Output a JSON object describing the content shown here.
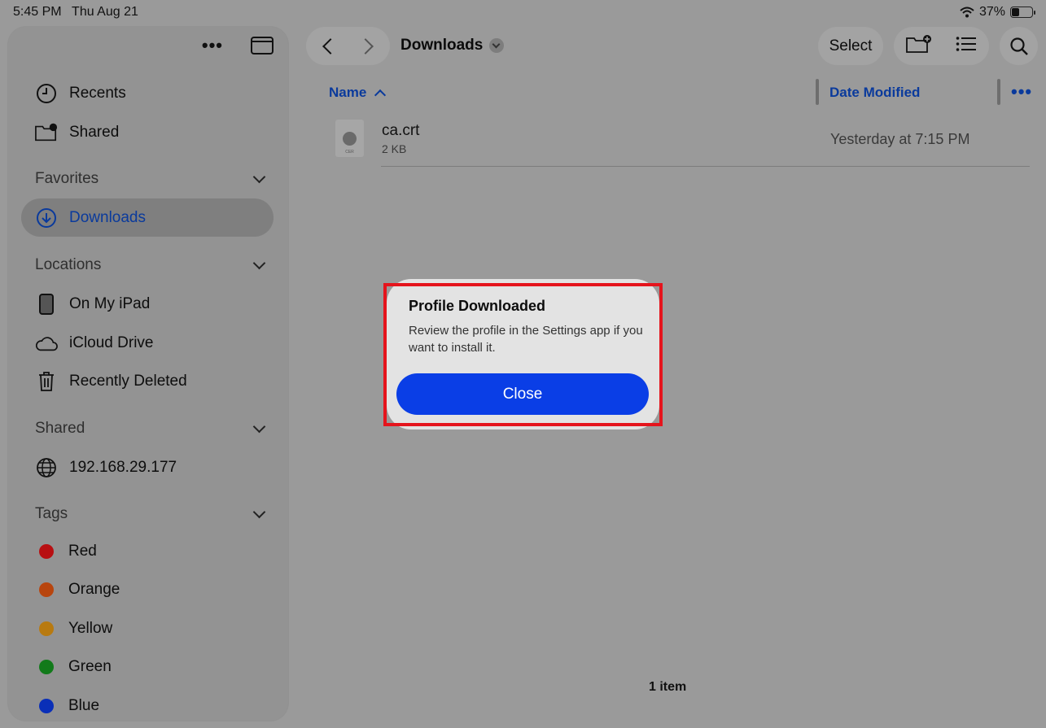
{
  "status_bar": {
    "time": "5:45 PM",
    "date": "Thu Aug 21",
    "battery": "37%",
    "battery_level": 0.37
  },
  "sidebar": {
    "top_items": [
      {
        "label": "Recents",
        "icon": "clock-icon"
      },
      {
        "label": "Shared",
        "icon": "shared-folder-icon"
      }
    ],
    "favorites": {
      "title": "Favorites",
      "items": [
        {
          "label": "Downloads",
          "icon": "download-icon",
          "selected": true
        }
      ]
    },
    "locations": {
      "title": "Locations",
      "items": [
        {
          "label": "On My iPad",
          "icon": "ipad-icon"
        },
        {
          "label": "iCloud Drive",
          "icon": "cloud-icon"
        },
        {
          "label": "Recently Deleted",
          "icon": "trash-icon"
        }
      ]
    },
    "shared": {
      "title": "Shared",
      "items": [
        {
          "label": "192.168.29.177",
          "icon": "globe-icon"
        }
      ]
    },
    "tags": {
      "title": "Tags",
      "items": [
        {
          "label": "Red",
          "color": "#b80f12"
        },
        {
          "label": "Orange",
          "color": "#b8450e"
        },
        {
          "label": "Yellow",
          "color": "#b87a10"
        },
        {
          "label": "Green",
          "color": "#127a1a"
        },
        {
          "label": "Blue",
          "color": "#0a2fb8"
        }
      ]
    }
  },
  "toolbar": {
    "title": "Downloads",
    "select_label": "Select"
  },
  "columns": {
    "name": "Name",
    "date": "Date Modified"
  },
  "files": [
    {
      "name": "ca.crt",
      "size": "2 KB",
      "modified": "Yesterday at 7:15 PM",
      "ext": "CER"
    }
  ],
  "footer": {
    "count": "1 item"
  },
  "dialog": {
    "title": "Profile Downloaded",
    "message": "Review the profile in the Settings app if you want to install it.",
    "close_label": "Close"
  },
  "colors": {
    "accent": "#0a3ee6",
    "highlight_border": "#e5141c"
  }
}
